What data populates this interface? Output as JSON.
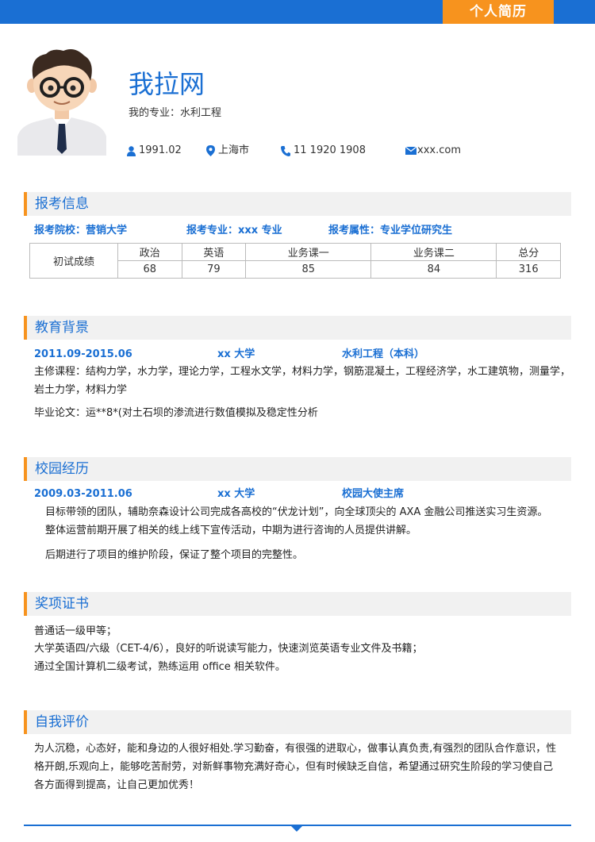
{
  "header": {
    "tag": "个人简历"
  },
  "profile": {
    "name": "我拉网",
    "major": "我的专业：水利工程",
    "birth": "1991.02",
    "city": "上海市",
    "phone": "11 1920 1908",
    "email": "xxx.com"
  },
  "sections": {
    "apply": "报考信息",
    "education": "教育背景",
    "campus": "校园经历",
    "awards": "奖项证书",
    "self": "自我评价"
  },
  "apply": {
    "school": "报考院校：营销大学",
    "major": "报考专业：xxx 专业",
    "type": "报考属性：专业学位研究生",
    "table_row_label": "初试成绩",
    "subjects": [
      "政治",
      "英语",
      "业务课一",
      "业务课二",
      "总分"
    ],
    "scores": [
      "68",
      "79",
      "85",
      "84",
      "316"
    ]
  },
  "education": {
    "period": "2011.09-2015.06",
    "school": "xx 大学",
    "degree": "水利工程（本科）",
    "courses_line1": "主修课程：结构力学，水力学，理论力学，工程水文学，材料力学，钢筋混凝土，工程经济学，水工建筑物，测量学，",
    "courses_line2": "岩土力学，材料力学",
    "thesis": "毕业论文：运**8*(对土石坝的渗流进行数值模拟及稳定性分析"
  },
  "campus": {
    "period": "2009.03-2011.06",
    "school": "xx 大学",
    "role": "校园大使主席",
    "line1": "目标带领的团队，辅助奈森设计公司完成各高校的“伏龙计划”，向全球顶尖的 AXA 金融公司推送实习生资源。",
    "line2": "整体运营前期开展了相关的线上线下宣传活动，中期为进行咨询的人员提供讲解。",
    "line3": "后期进行了项目的维护阶段，保证了整个项目的完整性。"
  },
  "awards": {
    "line1": "普通话一级甲等；",
    "line2": "大学英语四/六级（CET-4/6），良好的听说读写能力，快速浏览英语专业文件及书籍；",
    "line3": "通过全国计算机二级考试，熟练运用 office 相关软件。"
  },
  "self": {
    "line1": "为人沉稳，心态好，能和身边的人很好相处.学习勤奋，有很强的进取心，做事认真负责,有强烈的团队合作意识，性",
    "line2": "格开朗,乐观向上，能够吃苦耐劳，对新鲜事物充满好奇心，但有时候缺乏自信，希望通过研究生阶段的学习使自己",
    "line3": "各方面得到提高，让自己更加优秀！"
  },
  "colors": {
    "accent": "#1a6fd3",
    "orange": "#f7931e",
    "section_bg": "#f1f1f1"
  },
  "icons": [
    "person-icon",
    "location-pin-icon",
    "phone-icon",
    "email-icon"
  ]
}
